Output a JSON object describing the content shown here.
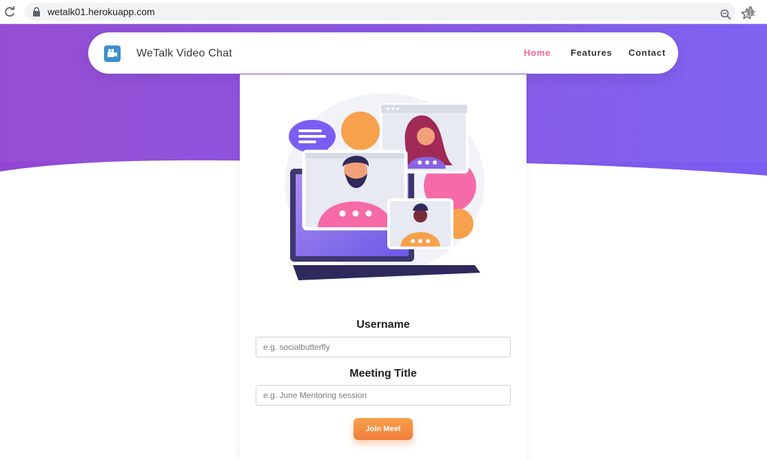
{
  "browser": {
    "url": "wetalk01.herokuapp.com",
    "icons": [
      "reload-icon",
      "lock-icon",
      "zoom-icon",
      "star-icon",
      "extension-icon"
    ]
  },
  "nav": {
    "brand": "WeTalk Video Chat",
    "items": [
      {
        "label": "Home",
        "active": true
      },
      {
        "label": "Features",
        "active": false
      },
      {
        "label": "Contact",
        "active": false
      }
    ]
  },
  "form": {
    "username_label": "Username",
    "username_placeholder": "e.g. socialbutterfly",
    "username_value": "",
    "title_label": "Meeting Title",
    "title_placeholder": "e.g. June Mentoring session",
    "title_value": "",
    "submit_label": "Join Meet"
  },
  "colors": {
    "hero_start": "#8e44d6",
    "hero_end": "#7b5ff0",
    "active_nav": "#f06292",
    "button": "#f28a42",
    "logo": "#3d8ec9"
  }
}
